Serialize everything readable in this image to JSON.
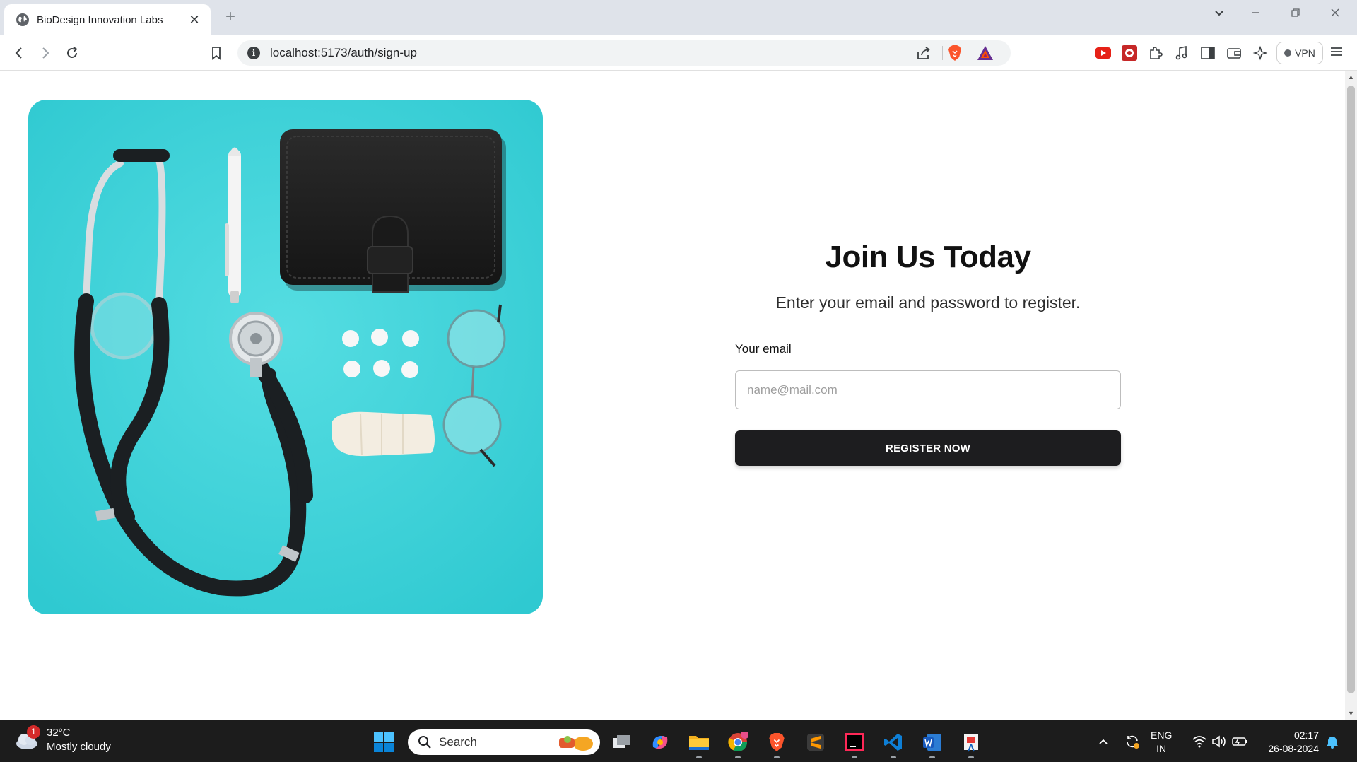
{
  "browser": {
    "tab_title": "BioDesign Innovation Labs",
    "tab_close": "✕",
    "new_tab": "+",
    "url": "localhost:5173/auth/sign-up",
    "vpn_label": "VPN"
  },
  "page": {
    "heading": "Join Us Today",
    "subheading": "Enter your email and password to register.",
    "email_label": "Your email",
    "email_placeholder": "name@mail.com",
    "email_value": "",
    "register_button": "REGISTER NOW",
    "hero_image_alt": "Stethoscope, notebook, pills, bandage and glasses on turquoise background"
  },
  "taskbar": {
    "weather_temp": "32°C",
    "weather_desc": "Mostly cloudy",
    "weather_badge": "1",
    "search_label": "Search",
    "lang_top": "ENG",
    "lang_bottom": "IN",
    "time": "02:17",
    "date": "26-08-2024"
  },
  "colors": {
    "accent_button": "#1d1d1f",
    "hero_background": "#3bd1d8"
  }
}
